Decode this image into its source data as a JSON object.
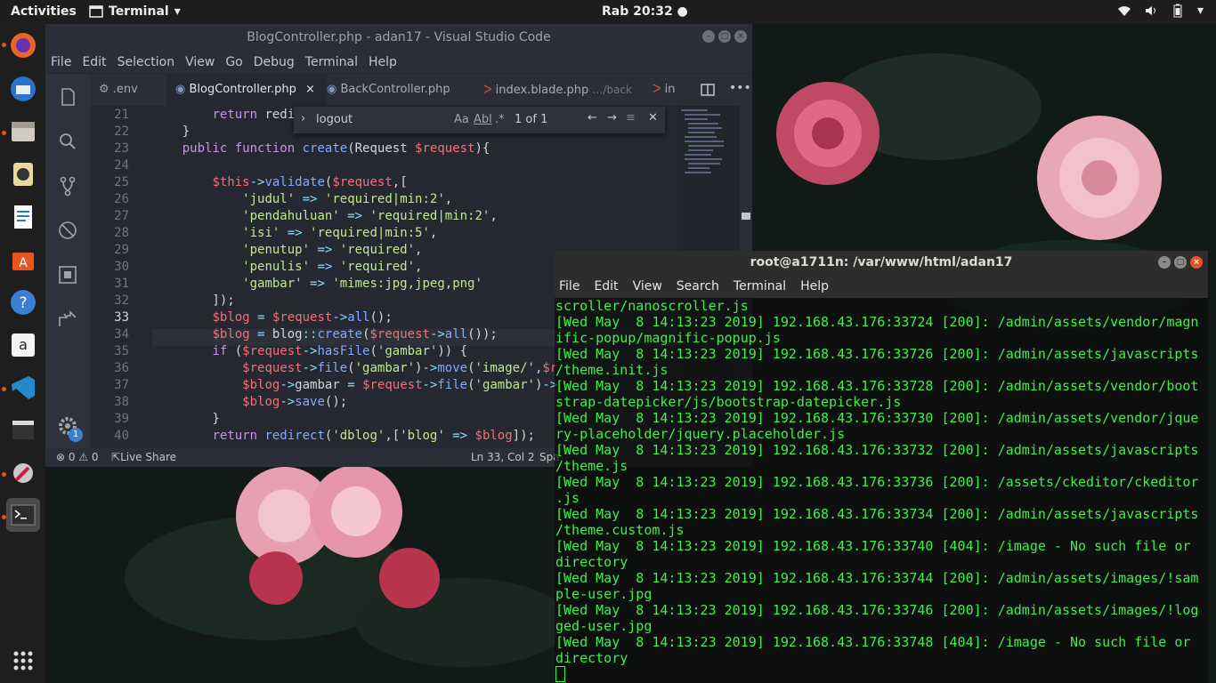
{
  "topbar": {
    "activities": "Activities",
    "app_name": "Terminal",
    "clock": "Rab 20:32 ●"
  },
  "dock": {
    "items": [
      "firefox-icon",
      "thunderbird-icon",
      "files-icon",
      "rhythmbox-icon",
      "writer-icon",
      "software-center-icon",
      "help-icon",
      "amazon-icon",
      "vscode-icon",
      "video-editor-icon",
      "settings-tool-icon",
      "terminal-icon"
    ]
  },
  "vscode": {
    "title": "BlogController.php - adan17 - Visual Studio Code",
    "menu": [
      "File",
      "Edit",
      "Selection",
      "View",
      "Go",
      "Debug",
      "Terminal",
      "Help"
    ],
    "tabs": [
      {
        "label": ".env",
        "active": false
      },
      {
        "label": "BlogController.php",
        "active": true,
        "close": "×"
      },
      {
        "label": "BackController.php",
        "active": false
      },
      {
        "label": "index.blade.php",
        "hint": "…/back",
        "active": false
      },
      {
        "label": "in",
        "active": false
      }
    ],
    "settings_badge": "1",
    "find": {
      "value": "logout",
      "options": [
        "Aa",
        "Abl",
        ".*"
      ],
      "count": "1 of 1"
    },
    "lines": [
      {
        "n": "21",
        "code": "        return redi"
      },
      {
        "n": "22",
        "code": "    }"
      },
      {
        "n": "23",
        "code": "    public function create(Request $request){"
      },
      {
        "n": "24",
        "code": ""
      },
      {
        "n": "25",
        "code": "        $this->validate($request,["
      },
      {
        "n": "26",
        "code": "            'judul' => 'required|min:2',"
      },
      {
        "n": "27",
        "code": "            'pendahuluan' => 'required|min:2',"
      },
      {
        "n": "28",
        "code": "            'isi' => 'required|min:5',"
      },
      {
        "n": "29",
        "code": "            'penutup' => 'required',"
      },
      {
        "n": "30",
        "code": "            'penulis' => 'required',"
      },
      {
        "n": "31",
        "code": "            'gambar' => 'mimes:jpg,jpeg,png'"
      },
      {
        "n": "32",
        "code": "        ]);"
      },
      {
        "n": "33",
        "code": "        $blog = $request->all();"
      },
      {
        "n": "34",
        "code": "        $blog = blog::create($request->all());"
      },
      {
        "n": "35",
        "code": "        if ($request->hasFile('gambar')) {"
      },
      {
        "n": "36",
        "code": "            $request->file('gambar')->move('image/',$r"
      },
      {
        "n": "37",
        "code": "            $blog->gambar = $request->file('gambar')->"
      },
      {
        "n": "38",
        "code": "            $blog->save();"
      },
      {
        "n": "39",
        "code": "        }"
      },
      {
        "n": "40",
        "code": "        return redirect('dblog',['blog' => $blog]);"
      }
    ],
    "status": {
      "errors": "0",
      "warnings": "0",
      "live_share": "Live Share",
      "position": "Ln 33, Col 2",
      "spaces": "Spa"
    }
  },
  "terminal": {
    "title": "root@a1711n: /var/www/html/adan17",
    "menu": [
      "File",
      "Edit",
      "View",
      "Search",
      "Terminal",
      "Help"
    ],
    "lines": [
      "scroller/nanoscroller.js",
      "[Wed May  8 14:13:23 2019] 192.168.43.176:33724 [200]: /admin/assets/vendor/magn",
      "ific-popup/magnific-popup.js",
      "[Wed May  8 14:13:23 2019] 192.168.43.176:33726 [200]: /admin/assets/javascripts",
      "/theme.init.js",
      "[Wed May  8 14:13:23 2019] 192.168.43.176:33728 [200]: /admin/assets/vendor/boot",
      "strap-datepicker/js/bootstrap-datepicker.js",
      "[Wed May  8 14:13:23 2019] 192.168.43.176:33730 [200]: /admin/assets/vendor/jque",
      "ry-placeholder/jquery.placeholder.js",
      "[Wed May  8 14:13:23 2019] 192.168.43.176:33732 [200]: /admin/assets/javascripts",
      "/theme.js",
      "[Wed May  8 14:13:23 2019] 192.168.43.176:33736 [200]: /assets/ckeditor/ckeditor",
      ".js",
      "[Wed May  8 14:13:23 2019] 192.168.43.176:33734 [200]: /admin/assets/javascripts",
      "/theme.custom.js",
      "[Wed May  8 14:13:23 2019] 192.168.43.176:33740 [404]: /image - No such file or",
      "directory",
      "[Wed May  8 14:13:23 2019] 192.168.43.176:33744 [200]: /admin/assets/images/!sam",
      "ple-user.jpg",
      "[Wed May  8 14:13:23 2019] 192.168.43.176:33746 [200]: /admin/assets/images/!log",
      "ged-user.jpg",
      "[Wed May  8 14:13:23 2019] 192.168.43.176:33748 [404]: /image - No such file or",
      "directory"
    ]
  }
}
